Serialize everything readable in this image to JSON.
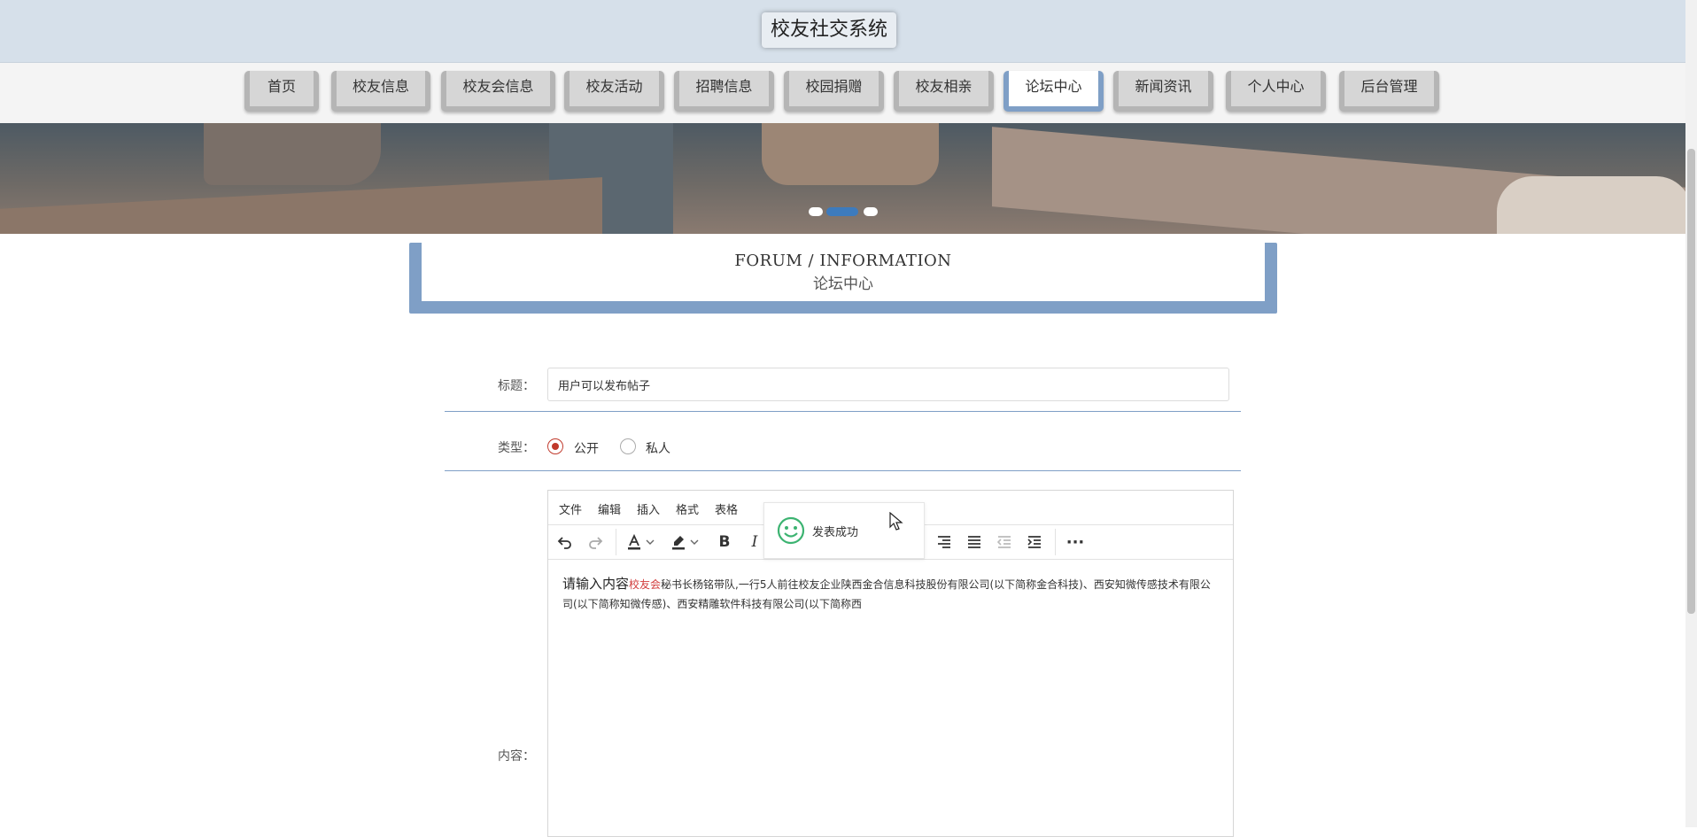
{
  "app": {
    "title": "校友社交系统"
  },
  "nav": {
    "items": [
      {
        "label": "首页"
      },
      {
        "label": "校友信息"
      },
      {
        "label": "校友会信息"
      },
      {
        "label": "校友活动"
      },
      {
        "label": "招聘信息"
      },
      {
        "label": "校园捐赠"
      },
      {
        "label": "校友相亲"
      },
      {
        "label": "论坛中心",
        "active": true
      },
      {
        "label": "新闻资讯"
      },
      {
        "label": "个人中心"
      },
      {
        "label": "后台管理"
      }
    ]
  },
  "carousel": {
    "slide_count": 3,
    "active_index": 1
  },
  "section": {
    "title_en": "FORUM / INFORMATION",
    "title_cn": "论坛中心"
  },
  "form": {
    "title_label": "标题：",
    "title_value": "用户可以发布帖子",
    "type_label": "类型：",
    "type_options": [
      {
        "label": "公开",
        "checked": true
      },
      {
        "label": "私人",
        "checked": false
      }
    ],
    "content_label": "内容："
  },
  "editor": {
    "menu": [
      "文件",
      "编辑",
      "插入",
      "格式",
      "表格"
    ],
    "content_lead": "请输入内容",
    "content_highlight": "校友会",
    "content_rest": "秘书长杨铭带队,一行5人前往校友企业陕西金合信息科技股份有限公司(以下简称金合科技)、西安知微传感技术有限公司(以下简称知微传感)、西安精雕软件科技有限公司(以下简称西"
  },
  "toast": {
    "message": "发表成功"
  },
  "colors": {
    "accent": "#7f9fc6",
    "radio_checked": "#c0392b",
    "toast_icon": "#3cb371",
    "highlight_text": "#d23c3c"
  }
}
